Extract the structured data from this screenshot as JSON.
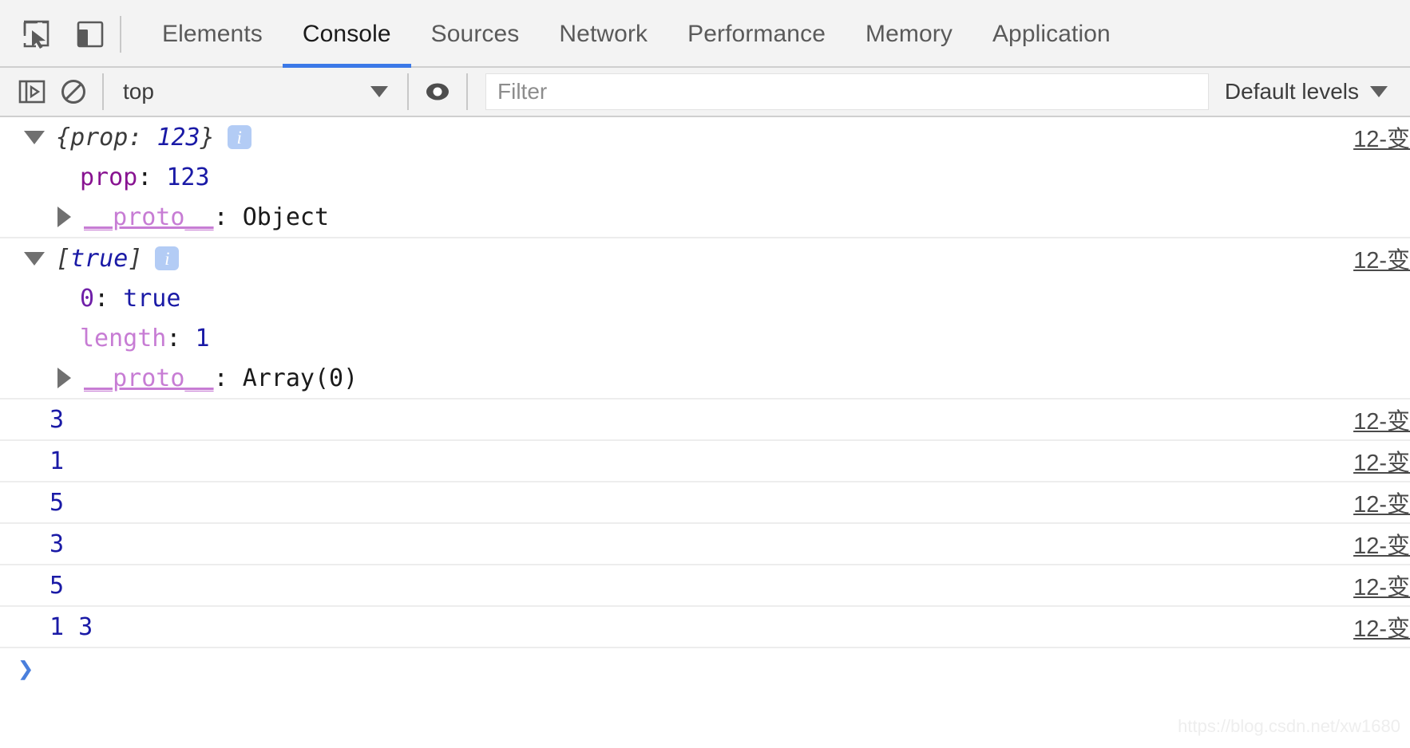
{
  "window": {
    "title": "Chrome DevTools — Console"
  },
  "tabbar": {
    "inspect_icon": "inspect-element-icon",
    "device_icon": "device-toolbar-icon",
    "tabs": [
      {
        "label": "Elements",
        "active": false
      },
      {
        "label": "Console",
        "active": true
      },
      {
        "label": "Sources",
        "active": false
      },
      {
        "label": "Network",
        "active": false
      },
      {
        "label": "Performance",
        "active": false
      },
      {
        "label": "Memory",
        "active": false
      },
      {
        "label": "Application",
        "active": false
      }
    ]
  },
  "toolbar": {
    "sidebar_icon": "console-sidebar-icon",
    "clear_icon": "clear-console-icon",
    "context_selected": "top",
    "eye_icon": "live-expression-icon",
    "filter_value": "",
    "filter_placeholder": "Filter",
    "levels_label": "Default levels",
    "levels_caret": "chevron-down-icon"
  },
  "console": {
    "source_link": "12-变",
    "entries": [
      {
        "type": "object",
        "preview_open": "{",
        "preview_key": "prop: ",
        "preview_value": "123",
        "preview_close": "}",
        "badge": "i",
        "props": [
          {
            "key": "prop",
            "key_kind": "name",
            "value": "123",
            "value_kind": "num",
            "expander": "none"
          },
          {
            "key": "__proto__",
            "key_kind": "proto",
            "value": "Object",
            "value_kind": "obj",
            "expander": "right"
          }
        ]
      },
      {
        "type": "array",
        "preview_open": "[",
        "preview_key": "",
        "preview_value": "true",
        "preview_close": "]",
        "badge": "i",
        "props": [
          {
            "key": "0",
            "key_kind": "idx",
            "value": "true",
            "value_kind": "bool",
            "expander": "none"
          },
          {
            "key": "length",
            "key_kind": "length",
            "value": "1",
            "value_kind": "num",
            "expander": "none"
          },
          {
            "key": "__proto__",
            "key_kind": "proto",
            "value": "Array(0)",
            "value_kind": "obj",
            "expander": "right"
          }
        ]
      },
      {
        "type": "value",
        "value": "3"
      },
      {
        "type": "value",
        "value": "1"
      },
      {
        "type": "value",
        "value": "5"
      },
      {
        "type": "value",
        "value": "3"
      },
      {
        "type": "value",
        "value": "5"
      },
      {
        "type": "value",
        "value": "1 3"
      }
    ],
    "prompt_symbol": "❯"
  },
  "watermark": "https://blog.csdn.net/xw1680",
  "colors": {
    "accent": "#3b78e7",
    "toolbar_bg": "#f3f3f3",
    "value_blue": "#1a1aa6",
    "key_purple": "#881391",
    "proto_purple": "#c77cd4",
    "badge_blue": "#b3ccf5"
  }
}
